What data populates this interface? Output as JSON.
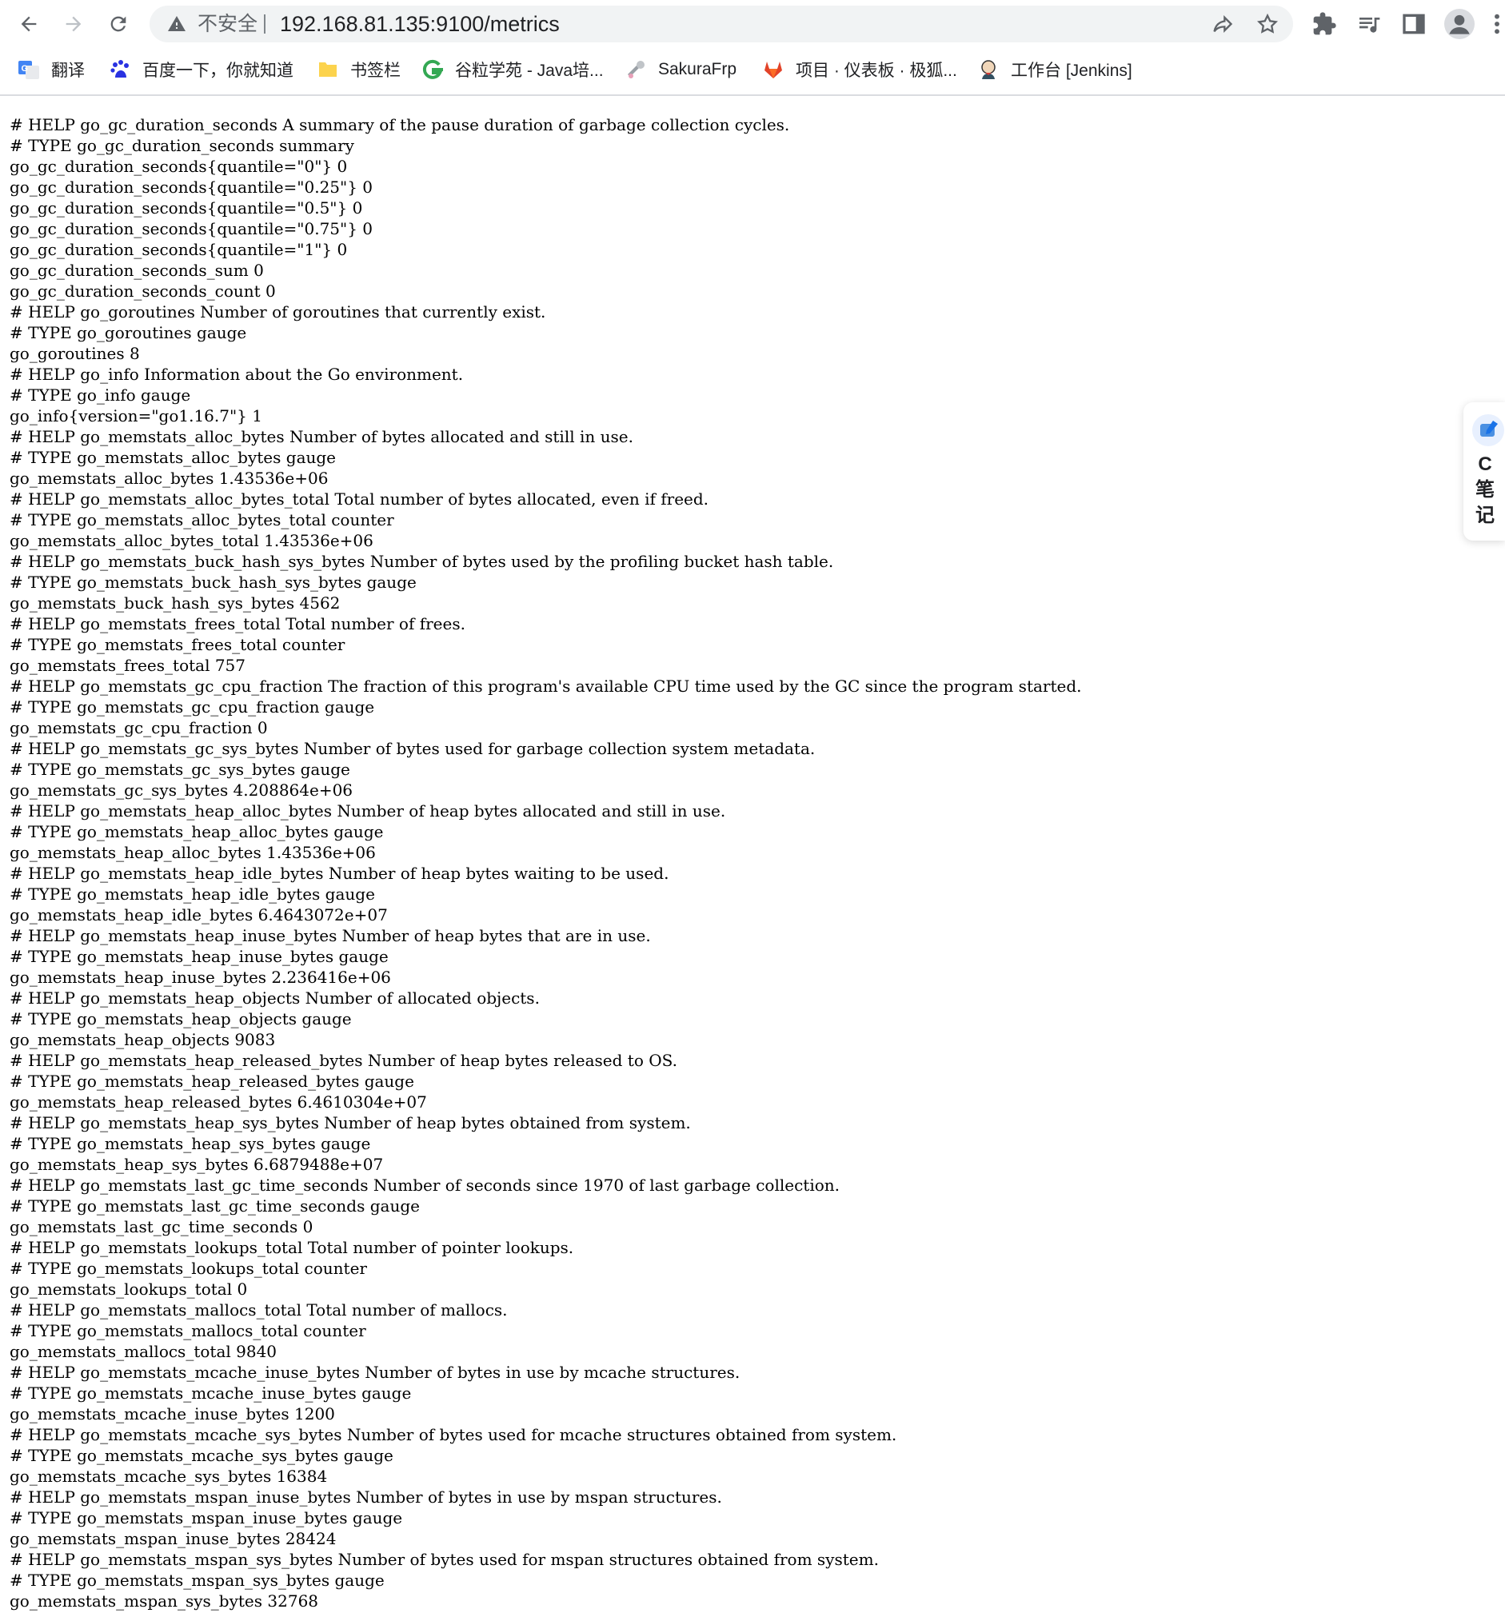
{
  "browser": {
    "security_label": "不安全",
    "url": "192.168.81.135:9100/metrics"
  },
  "bookmarks": [
    {
      "label": "翻译",
      "icon": "google-translate-icon"
    },
    {
      "label": "百度一下，你就知道",
      "icon": "baidu-paw-icon"
    },
    {
      "label": "书签栏",
      "icon": "folder-icon"
    },
    {
      "label": "谷粒学苑 - Java培...",
      "icon": "guli-g-icon"
    },
    {
      "label": "SakuraFrp",
      "icon": "sakura-icon"
    },
    {
      "label": "项目 · 仪表板 · 极狐...",
      "icon": "gitlab-fox-icon"
    },
    {
      "label": "工作台 [Jenkins]",
      "icon": "jenkins-icon"
    }
  ],
  "side_widget": {
    "label": "C笔记"
  },
  "metrics_lines": [
    "# HELP go_gc_duration_seconds A summary of the pause duration of garbage collection cycles.",
    "# TYPE go_gc_duration_seconds summary",
    "go_gc_duration_seconds{quantile=\"0\"} 0",
    "go_gc_duration_seconds{quantile=\"0.25\"} 0",
    "go_gc_duration_seconds{quantile=\"0.5\"} 0",
    "go_gc_duration_seconds{quantile=\"0.75\"} 0",
    "go_gc_duration_seconds{quantile=\"1\"} 0",
    "go_gc_duration_seconds_sum 0",
    "go_gc_duration_seconds_count 0",
    "# HELP go_goroutines Number of goroutines that currently exist.",
    "# TYPE go_goroutines gauge",
    "go_goroutines 8",
    "# HELP go_info Information about the Go environment.",
    "# TYPE go_info gauge",
    "go_info{version=\"go1.16.7\"} 1",
    "# HELP go_memstats_alloc_bytes Number of bytes allocated and still in use.",
    "# TYPE go_memstats_alloc_bytes gauge",
    "go_memstats_alloc_bytes 1.43536e+06",
    "# HELP go_memstats_alloc_bytes_total Total number of bytes allocated, even if freed.",
    "# TYPE go_memstats_alloc_bytes_total counter",
    "go_memstats_alloc_bytes_total 1.43536e+06",
    "# HELP go_memstats_buck_hash_sys_bytes Number of bytes used by the profiling bucket hash table.",
    "# TYPE go_memstats_buck_hash_sys_bytes gauge",
    "go_memstats_buck_hash_sys_bytes 4562",
    "# HELP go_memstats_frees_total Total number of frees.",
    "# TYPE go_memstats_frees_total counter",
    "go_memstats_frees_total 757",
    "# HELP go_memstats_gc_cpu_fraction The fraction of this program's available CPU time used by the GC since the program started.",
    "# TYPE go_memstats_gc_cpu_fraction gauge",
    "go_memstats_gc_cpu_fraction 0",
    "# HELP go_memstats_gc_sys_bytes Number of bytes used for garbage collection system metadata.",
    "# TYPE go_memstats_gc_sys_bytes gauge",
    "go_memstats_gc_sys_bytes 4.208864e+06",
    "# HELP go_memstats_heap_alloc_bytes Number of heap bytes allocated and still in use.",
    "# TYPE go_memstats_heap_alloc_bytes gauge",
    "go_memstats_heap_alloc_bytes 1.43536e+06",
    "# HELP go_memstats_heap_idle_bytes Number of heap bytes waiting to be used.",
    "# TYPE go_memstats_heap_idle_bytes gauge",
    "go_memstats_heap_idle_bytes 6.4643072e+07",
    "# HELP go_memstats_heap_inuse_bytes Number of heap bytes that are in use.",
    "# TYPE go_memstats_heap_inuse_bytes gauge",
    "go_memstats_heap_inuse_bytes 2.236416e+06",
    "# HELP go_memstats_heap_objects Number of allocated objects.",
    "# TYPE go_memstats_heap_objects gauge",
    "go_memstats_heap_objects 9083",
    "# HELP go_memstats_heap_released_bytes Number of heap bytes released to OS.",
    "# TYPE go_memstats_heap_released_bytes gauge",
    "go_memstats_heap_released_bytes 6.4610304e+07",
    "# HELP go_memstats_heap_sys_bytes Number of heap bytes obtained from system.",
    "# TYPE go_memstats_heap_sys_bytes gauge",
    "go_memstats_heap_sys_bytes 6.6879488e+07",
    "# HELP go_memstats_last_gc_time_seconds Number of seconds since 1970 of last garbage collection.",
    "# TYPE go_memstats_last_gc_time_seconds gauge",
    "go_memstats_last_gc_time_seconds 0",
    "# HELP go_memstats_lookups_total Total number of pointer lookups.",
    "# TYPE go_memstats_lookups_total counter",
    "go_memstats_lookups_total 0",
    "# HELP go_memstats_mallocs_total Total number of mallocs.",
    "# TYPE go_memstats_mallocs_total counter",
    "go_memstats_mallocs_total 9840",
    "# HELP go_memstats_mcache_inuse_bytes Number of bytes in use by mcache structures.",
    "# TYPE go_memstats_mcache_inuse_bytes gauge",
    "go_memstats_mcache_inuse_bytes 1200",
    "# HELP go_memstats_mcache_sys_bytes Number of bytes used for mcache structures obtained from system.",
    "# TYPE go_memstats_mcache_sys_bytes gauge",
    "go_memstats_mcache_sys_bytes 16384",
    "# HELP go_memstats_mspan_inuse_bytes Number of bytes in use by mspan structures.",
    "# TYPE go_memstats_mspan_inuse_bytes gauge",
    "go_memstats_mspan_inuse_bytes 28424",
    "# HELP go_memstats_mspan_sys_bytes Number of bytes used for mspan structures obtained from system.",
    "# TYPE go_memstats_mspan_sys_bytes gauge",
    "go_memstats_mspan_sys_bytes 32768"
  ]
}
